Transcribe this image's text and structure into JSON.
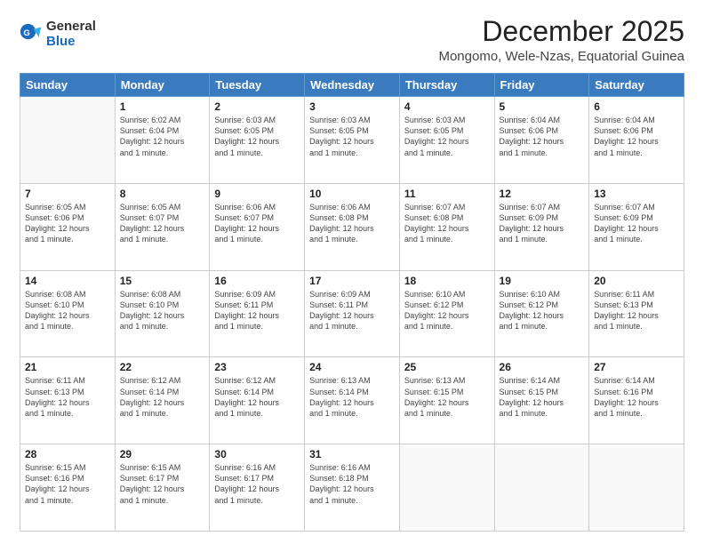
{
  "header": {
    "logo": {
      "general": "General",
      "blue": "Blue"
    },
    "month": "December 2025",
    "location": "Mongomo, Wele-Nzas, Equatorial Guinea"
  },
  "calendar": {
    "weekdays": [
      "Sunday",
      "Monday",
      "Tuesday",
      "Wednesday",
      "Thursday",
      "Friday",
      "Saturday"
    ],
    "weeks": [
      [
        {
          "day": "",
          "empty": true
        },
        {
          "day": "1",
          "sunrise": "6:02 AM",
          "sunset": "6:04 PM",
          "daylight": "12 hours and 1 minute."
        },
        {
          "day": "2",
          "sunrise": "6:03 AM",
          "sunset": "6:05 PM",
          "daylight": "12 hours and 1 minute."
        },
        {
          "day": "3",
          "sunrise": "6:03 AM",
          "sunset": "6:05 PM",
          "daylight": "12 hours and 1 minute."
        },
        {
          "day": "4",
          "sunrise": "6:03 AM",
          "sunset": "6:05 PM",
          "daylight": "12 hours and 1 minute."
        },
        {
          "day": "5",
          "sunrise": "6:04 AM",
          "sunset": "6:06 PM",
          "daylight": "12 hours and 1 minute."
        },
        {
          "day": "6",
          "sunrise": "6:04 AM",
          "sunset": "6:06 PM",
          "daylight": "12 hours and 1 minute."
        }
      ],
      [
        {
          "day": "7",
          "sunrise": "6:05 AM",
          "sunset": "6:06 PM",
          "daylight": "12 hours and 1 minute."
        },
        {
          "day": "8",
          "sunrise": "6:05 AM",
          "sunset": "6:07 PM",
          "daylight": "12 hours and 1 minute."
        },
        {
          "day": "9",
          "sunrise": "6:06 AM",
          "sunset": "6:07 PM",
          "daylight": "12 hours and 1 minute."
        },
        {
          "day": "10",
          "sunrise": "6:06 AM",
          "sunset": "6:08 PM",
          "daylight": "12 hours and 1 minute."
        },
        {
          "day": "11",
          "sunrise": "6:07 AM",
          "sunset": "6:08 PM",
          "daylight": "12 hours and 1 minute."
        },
        {
          "day": "12",
          "sunrise": "6:07 AM",
          "sunset": "6:09 PM",
          "daylight": "12 hours and 1 minute."
        },
        {
          "day": "13",
          "sunrise": "6:07 AM",
          "sunset": "6:09 PM",
          "daylight": "12 hours and 1 minute."
        }
      ],
      [
        {
          "day": "14",
          "sunrise": "6:08 AM",
          "sunset": "6:10 PM",
          "daylight": "12 hours and 1 minute."
        },
        {
          "day": "15",
          "sunrise": "6:08 AM",
          "sunset": "6:10 PM",
          "daylight": "12 hours and 1 minute."
        },
        {
          "day": "16",
          "sunrise": "6:09 AM",
          "sunset": "6:11 PM",
          "daylight": "12 hours and 1 minute."
        },
        {
          "day": "17",
          "sunrise": "6:09 AM",
          "sunset": "6:11 PM",
          "daylight": "12 hours and 1 minute."
        },
        {
          "day": "18",
          "sunrise": "6:10 AM",
          "sunset": "6:12 PM",
          "daylight": "12 hours and 1 minute."
        },
        {
          "day": "19",
          "sunrise": "6:10 AM",
          "sunset": "6:12 PM",
          "daylight": "12 hours and 1 minute."
        },
        {
          "day": "20",
          "sunrise": "6:11 AM",
          "sunset": "6:13 PM",
          "daylight": "12 hours and 1 minute."
        }
      ],
      [
        {
          "day": "21",
          "sunrise": "6:11 AM",
          "sunset": "6:13 PM",
          "daylight": "12 hours and 1 minute."
        },
        {
          "day": "22",
          "sunrise": "6:12 AM",
          "sunset": "6:14 PM",
          "daylight": "12 hours and 1 minute."
        },
        {
          "day": "23",
          "sunrise": "6:12 AM",
          "sunset": "6:14 PM",
          "daylight": "12 hours and 1 minute."
        },
        {
          "day": "24",
          "sunrise": "6:13 AM",
          "sunset": "6:14 PM",
          "daylight": "12 hours and 1 minute."
        },
        {
          "day": "25",
          "sunrise": "6:13 AM",
          "sunset": "6:15 PM",
          "daylight": "12 hours and 1 minute."
        },
        {
          "day": "26",
          "sunrise": "6:14 AM",
          "sunset": "6:15 PM",
          "daylight": "12 hours and 1 minute."
        },
        {
          "day": "27",
          "sunrise": "6:14 AM",
          "sunset": "6:16 PM",
          "daylight": "12 hours and 1 minute."
        }
      ],
      [
        {
          "day": "28",
          "sunrise": "6:15 AM",
          "sunset": "6:16 PM",
          "daylight": "12 hours and 1 minute."
        },
        {
          "day": "29",
          "sunrise": "6:15 AM",
          "sunset": "6:17 PM",
          "daylight": "12 hours and 1 minute."
        },
        {
          "day": "30",
          "sunrise": "6:16 AM",
          "sunset": "6:17 PM",
          "daylight": "12 hours and 1 minute."
        },
        {
          "day": "31",
          "sunrise": "6:16 AM",
          "sunset": "6:18 PM",
          "daylight": "12 hours and 1 minute."
        },
        {
          "day": "",
          "empty": true
        },
        {
          "day": "",
          "empty": true
        },
        {
          "day": "",
          "empty": true
        }
      ]
    ]
  }
}
